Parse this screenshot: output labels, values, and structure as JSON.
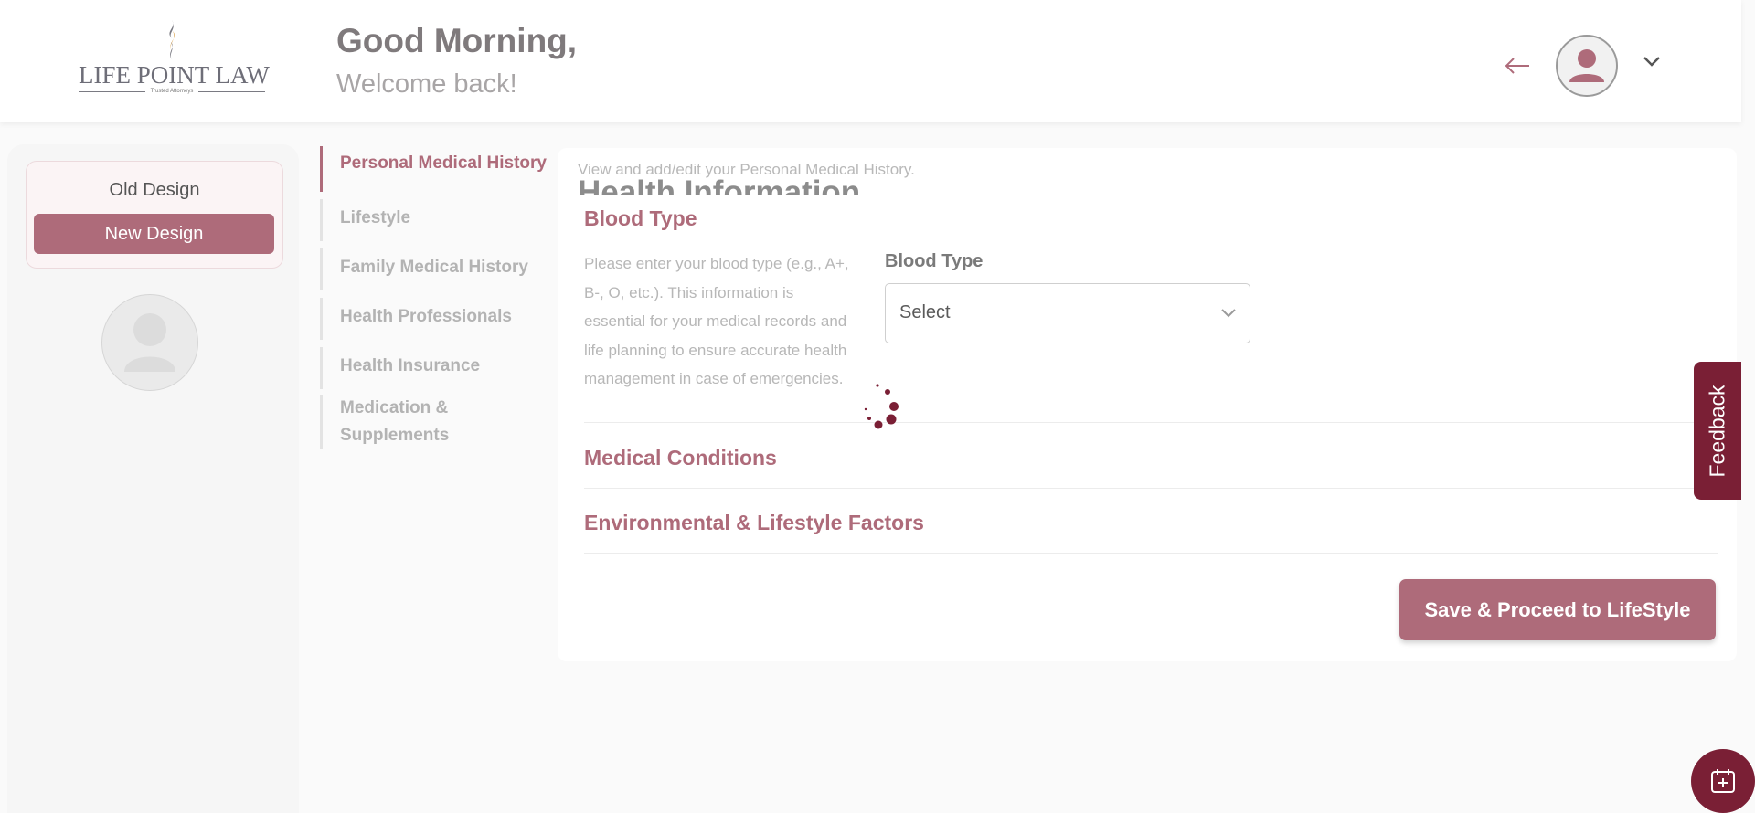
{
  "header": {
    "logo_text": "LIFE POINT LAW",
    "logo_tagline": "Trusted Attorneys",
    "greeting": "Good Morning,",
    "subgreeting": "Welcome back!"
  },
  "left_panel": {
    "old_design_label": "Old Design",
    "new_design_label": "New Design"
  },
  "nav": {
    "items": [
      {
        "label": "Personal Medical History"
      },
      {
        "label": "Lifestyle"
      },
      {
        "label": "Family Medical History"
      },
      {
        "label": "Health Professionals"
      },
      {
        "label": "Health Insurance"
      },
      {
        "label": "Medication & Supplements"
      }
    ],
    "active_index": 0
  },
  "main": {
    "subtitle": "View and add/edit your Personal Medical History.",
    "title": "Health Information",
    "sections": [
      {
        "title": "Blood Type",
        "description": "Please enter your blood type (e.g., A+, B-, O, etc.). This information is essential for your medical records and life planning to ensure accurate health management in case of emergencies.",
        "field_label": "Blood Type",
        "select_value": "Select"
      },
      {
        "title": "Medical Conditions"
      },
      {
        "title": "Environmental & Lifestyle Factors"
      }
    ],
    "save_button": "Save & Proceed to LifeStyle"
  },
  "feedback_label": "Feedback",
  "icons": {
    "back": "arrow-left-icon",
    "avatar": "user-avatar-icon",
    "menu": "chevron-down-icon",
    "loading": "spinner-icon",
    "calendar": "calendar-plus-icon"
  },
  "colors": {
    "accent": "#ae6b7a",
    "dark_accent": "#7a1f35"
  }
}
